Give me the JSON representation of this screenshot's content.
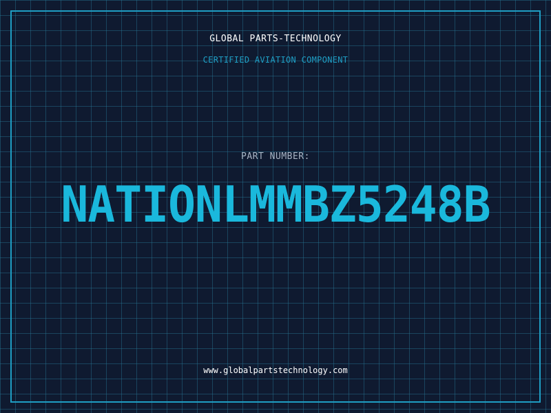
{
  "header": {
    "company": "GLOBAL PARTS-TECHNOLOGY",
    "tagline": "CERTIFIED AVIATION COMPONENT"
  },
  "part": {
    "label": "PART NUMBER:",
    "number": "NATIONLMMBZ5248B"
  },
  "footer": {
    "url": "www.globalpartstechnology.com"
  },
  "colors": {
    "background": "#0f1a30",
    "grid": "#28788f",
    "accent": "#1f9ec4",
    "part_number": "#1ab8dc",
    "text": "#ffffff",
    "muted_text": "#a9b4c4"
  }
}
